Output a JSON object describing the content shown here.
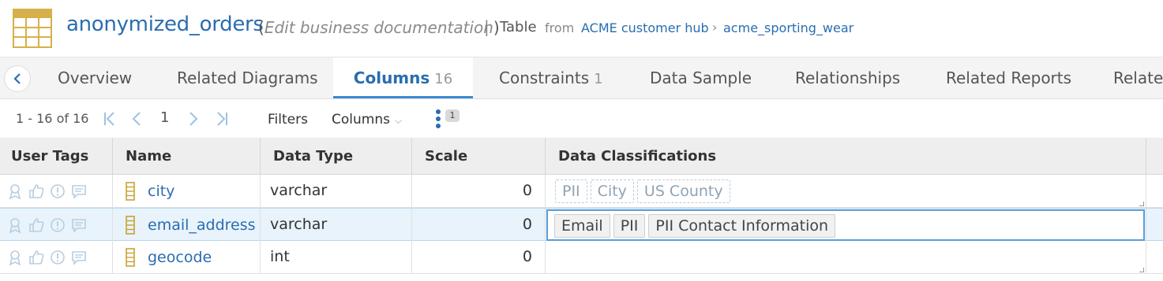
{
  "header": {
    "title": "anonymized_orders",
    "edit_open": "(",
    "edit_label": "Edit business documentation",
    "edit_close": ")",
    "separator": "|",
    "object_type": "Table",
    "from_label": "from",
    "breadcrumb": [
      "ACME customer hub",
      "acme_sporting_wear"
    ],
    "breadcrumb_separator": "›",
    "icon": "table-icon"
  },
  "tabs": [
    {
      "label": "Overview",
      "count": ""
    },
    {
      "label": "Related Diagrams",
      "count": ""
    },
    {
      "label": "Columns",
      "count": "16",
      "active": true
    },
    {
      "label": "Constraints",
      "count": "1"
    },
    {
      "label": "Data Sample",
      "count": ""
    },
    {
      "label": "Relationships",
      "count": ""
    },
    {
      "label": "Related Reports",
      "count": ""
    },
    {
      "label": "Related",
      "count": ""
    }
  ],
  "toolbar": {
    "range": "1 - 16 of 16",
    "page": "1",
    "filters": "Filters",
    "columns": "Columns",
    "badge": "1"
  },
  "grid": {
    "headers": [
      "User Tags",
      "Name",
      "Data Type",
      "Scale",
      "Data Classifications"
    ],
    "rows": [
      {
        "name": "city",
        "data_type": "varchar",
        "scale": "0",
        "classifications": [
          "PII",
          "City",
          "US County"
        ],
        "selected": false
      },
      {
        "name": "email_address",
        "data_type": "varchar",
        "scale": "0",
        "classifications": [
          "Email",
          "PII",
          "PII Contact Information"
        ],
        "selected": true
      },
      {
        "name": "geocode",
        "data_type": "int",
        "scale": "0",
        "classifications": [],
        "selected": false
      }
    ]
  },
  "colors": {
    "accent": "#2a6db0",
    "tab_underline": "#3b8ad2",
    "selected_row": "#e8f3fb",
    "table_icon": "#d6b04a"
  }
}
